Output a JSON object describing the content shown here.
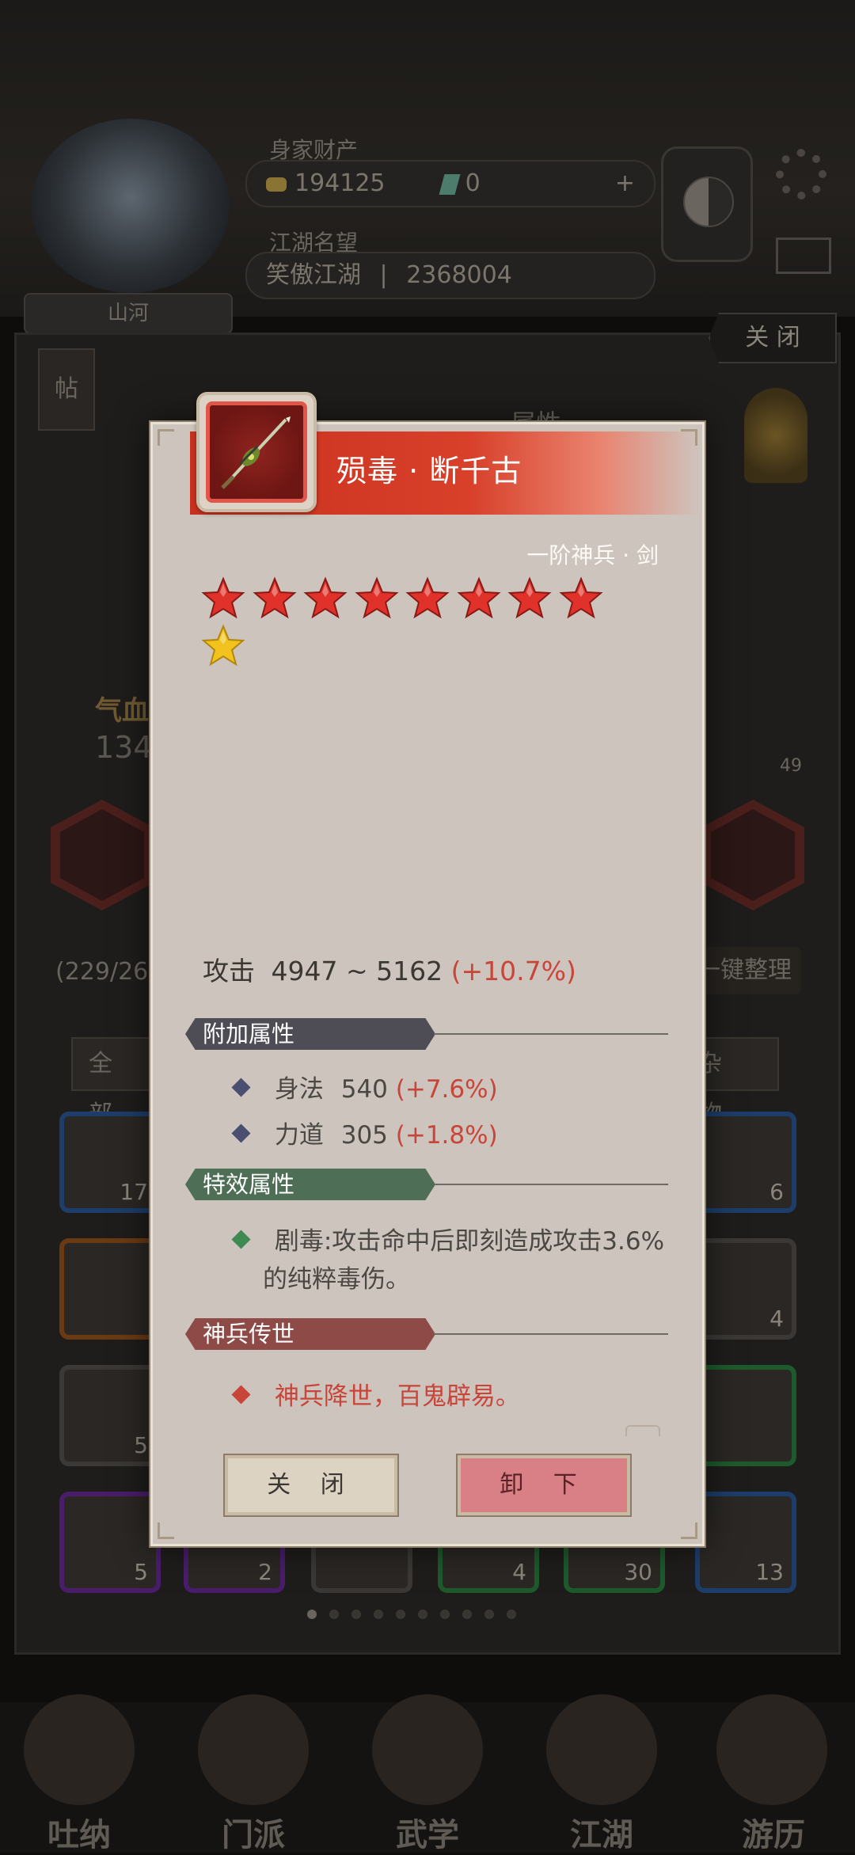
{
  "background": {
    "assets_label": "身家财产",
    "coins": "194125",
    "gems": "0",
    "plus": "+",
    "fame_label": "江湖名望",
    "fame_name": "笑傲江湖",
    "fame_sep": "|",
    "fame_value": "2368004",
    "player_name": "山河",
    "close_top": "关 闭",
    "post_tag": "帖",
    "attr_tab": "属性",
    "hp_label": "气血",
    "hp_value": "134",
    "bag_count": "(229/26",
    "sort_button": "一键整理",
    "tab_all": "全 部",
    "tab_misc": "杂 物",
    "page_hint": "49",
    "slot_counts": [
      "17",
      "6",
      "4",
      "5",
      "5",
      "2",
      "4",
      "30",
      "13"
    ],
    "nav": [
      "吐纳",
      "门派",
      "武学",
      "江湖",
      "游历"
    ]
  },
  "item": {
    "name": "殒毒 · 断千古",
    "grade": "一阶神兵 · 剑",
    "stars_total": 9,
    "stars_red": 8,
    "stars_gold": 1,
    "attack_label": "攻击",
    "attack_value": "4947 ~ 5162",
    "attack_pct": "(+10.7%)"
  },
  "sections": {
    "extra": {
      "title": "附加属性",
      "rows": [
        {
          "name": "身法",
          "value": "540",
          "pct": "(+7.6%)"
        },
        {
          "name": "力道",
          "value": "305",
          "pct": "(+1.8%)"
        }
      ]
    },
    "special": {
      "title": "特效属性",
      "line1": "剧毒:攻击命中后即刻造成攻击3.6%",
      "line2": "的纯粹毒伤。"
    },
    "legend": {
      "title": "神兵传世",
      "text": "神兵降世，百鬼辟易。"
    }
  },
  "buttons": {
    "close": "关 闭",
    "unequip": "卸 下"
  },
  "colors": {
    "ribbon_red": "#d23b28",
    "star_red": "#e0322a",
    "star_gold": "#f2c21e",
    "extra_header": "#4e4d55",
    "special_header": "#4e6e55",
    "legend_header": "#8e4a46",
    "pct_red": "#c8453a"
  }
}
